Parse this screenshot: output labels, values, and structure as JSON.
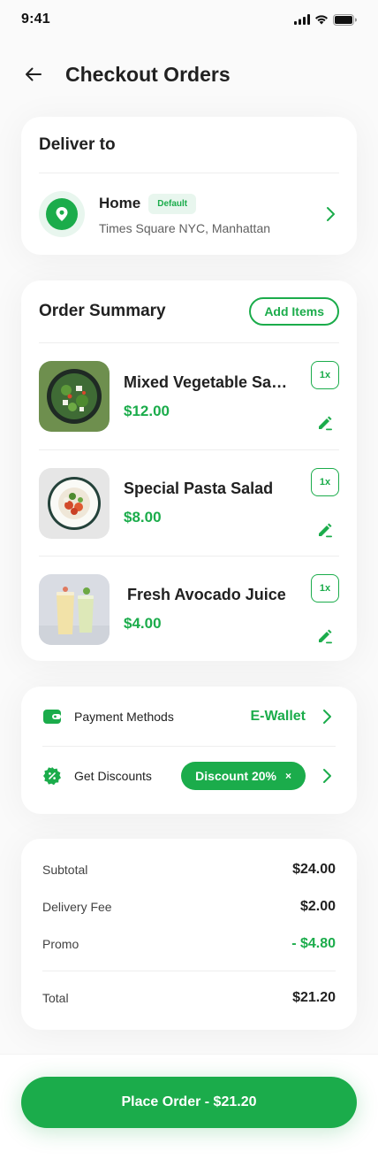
{
  "status_bar": {
    "time": "9:41"
  },
  "header": {
    "title": "Checkout Orders"
  },
  "deliver_to": {
    "title": "Deliver to",
    "address": {
      "name": "Home",
      "badge": "Default",
      "detail": "Times Square NYC, Manhattan"
    }
  },
  "order_summary": {
    "title": "Order Summary",
    "add_items_label": "Add Items",
    "items": [
      {
        "name": "Mixed Vegetable Salad",
        "price": "$12.00",
        "qty": "1x"
      },
      {
        "name": "Special Pasta Salad",
        "price": "$8.00",
        "qty": "1x"
      },
      {
        "name": "Fresh Avocado Juice",
        "price": "$4.00",
        "qty": "1x"
      }
    ]
  },
  "payment": {
    "methods_label": "Payment Methods",
    "methods_value": "E-Wallet",
    "discounts_label": "Get Discounts",
    "discount_chip": "Discount 20%",
    "chip_close": "×"
  },
  "totals": {
    "subtotal_label": "Subtotal",
    "subtotal_value": "$24.00",
    "delivery_label": "Delivery Fee",
    "delivery_value": "$2.00",
    "promo_label": "Promo",
    "promo_value": "- $4.80",
    "total_label": "Total",
    "total_value": "$21.20"
  },
  "place_order_label": "Place Order - $21.20",
  "colors": {
    "primary": "#1BAC4B",
    "primary_light": "#E8F6EE",
    "text_dark": "#212121",
    "background": "#FAFAFA"
  },
  "icons": [
    "back-arrow-icon",
    "location-pin-icon",
    "chevron-right-icon",
    "edit-icon",
    "wallet-icon",
    "discount-icon",
    "signal-icon",
    "wifi-icon",
    "battery-icon"
  ]
}
